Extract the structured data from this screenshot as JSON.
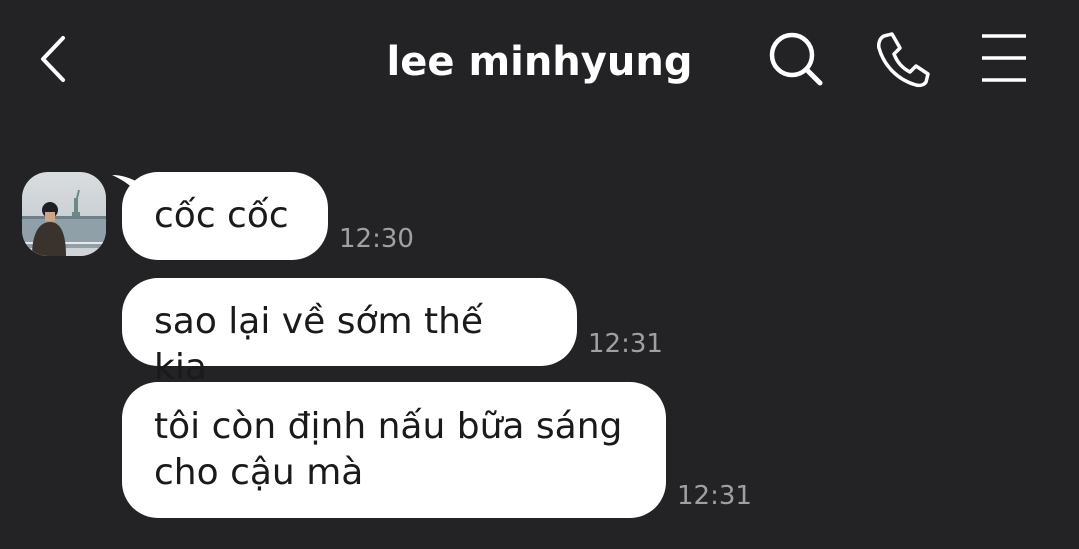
{
  "header": {
    "title": "lee minhyung",
    "back_icon": "chevron-left-icon",
    "search_icon": "search-icon",
    "call_icon": "phone-icon",
    "menu_icon": "menu-icon"
  },
  "colors": {
    "background": "#232325",
    "bubble": "#ffffff",
    "bubble_text": "#1a1a1a",
    "timestamp": "#a0a0a3",
    "header_text": "#ffffff"
  },
  "messages": [
    {
      "text": "cốc cốc",
      "time": "12:30"
    },
    {
      "text": "sao lại về sớm thế kia",
      "time": "12:31"
    },
    {
      "text": "tôi còn định nấu bữa sáng\ncho cậu mà",
      "time": "12:31"
    }
  ]
}
